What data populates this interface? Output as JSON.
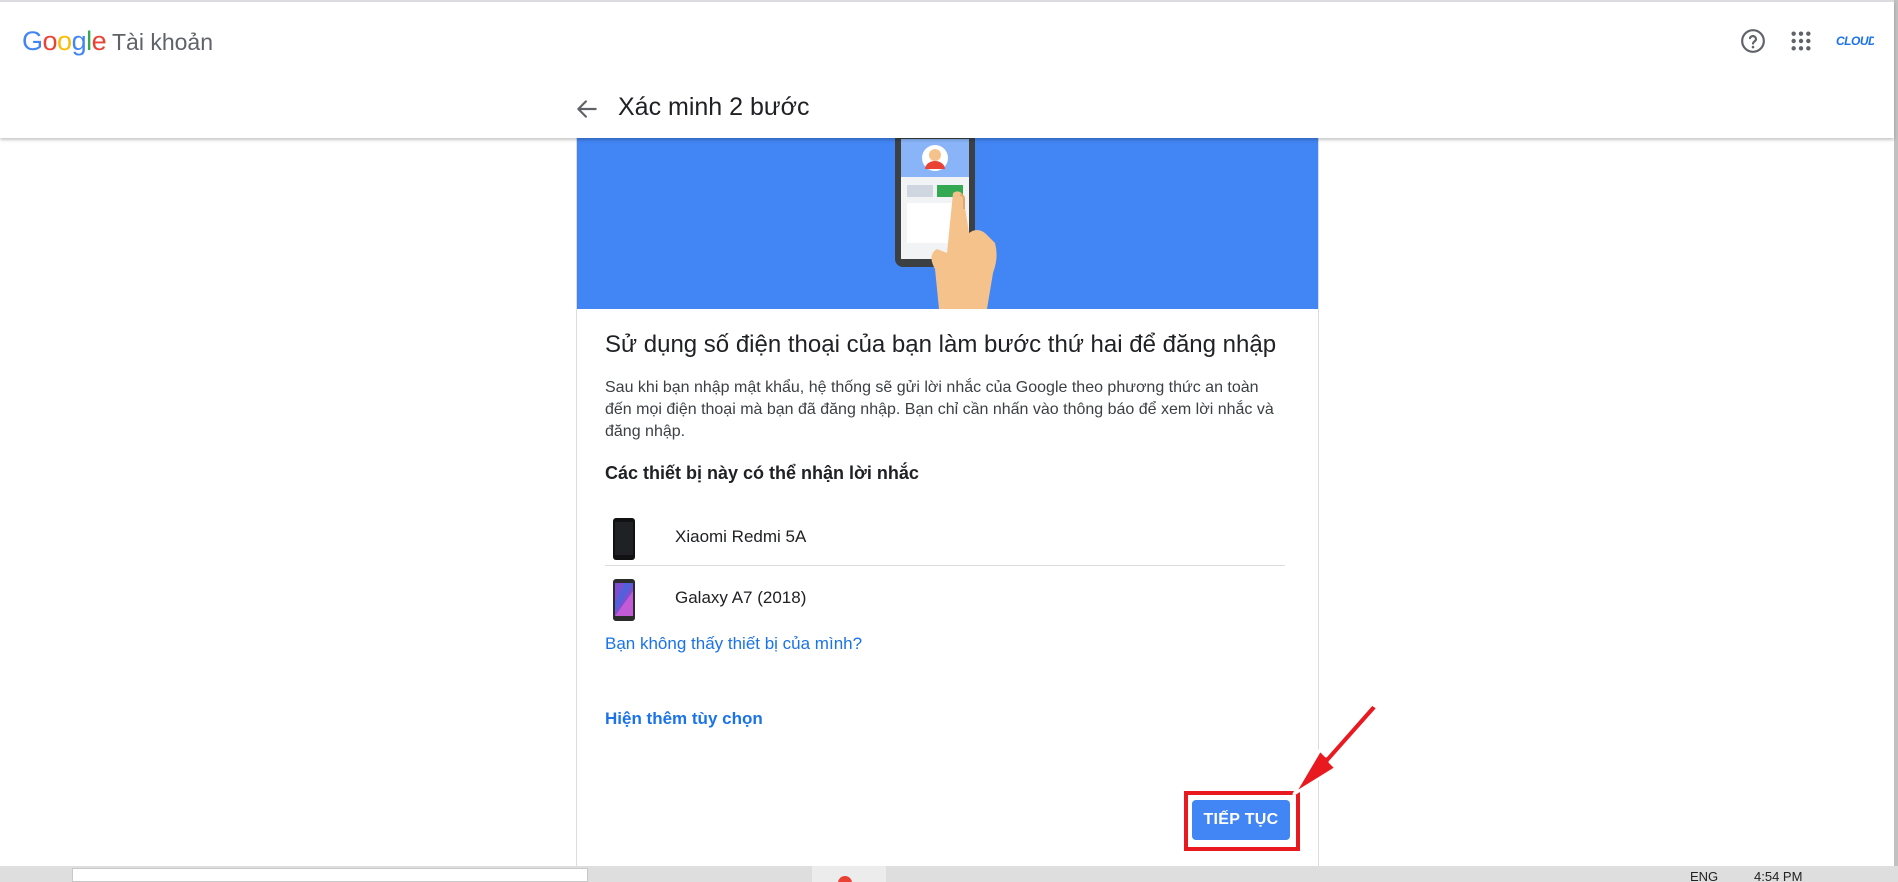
{
  "header": {
    "logo_letters": [
      "G",
      "o",
      "o",
      "g",
      "l",
      "e"
    ],
    "product": "Tài khoản",
    "avatar_text": "CLOUD",
    "title": "Xác minh 2 bước"
  },
  "icons": {
    "help": "help-circle-icon",
    "apps": "apps-grid-icon",
    "back": "arrow-back-icon",
    "phone": "smartphone-icon"
  },
  "colors": {
    "google_blue": "#4285f4",
    "link_blue": "#1a73e8",
    "highlight_red": "#e8191f"
  },
  "card": {
    "headline": "Sử dụng số điện thoại của bạn làm bước thứ hai để đăng nhập",
    "description": "Sau khi bạn nhập mật khẩu, hệ thống sẽ gửi lời nhắc của Google theo phương thức an toàn đến mọi điện thoại mà bạn đã đăng nhập. Bạn chỉ cần nhấn vào thông báo để xem lời nhắc và đăng nhập.",
    "devices_heading": "Các thiết bị này có thể nhận lời nhắc",
    "devices": [
      {
        "name": "Xiaomi Redmi 5A"
      },
      {
        "name": "Galaxy A7 (2018)"
      }
    ],
    "missing_device_link": "Bạn không thấy thiết bị của mình?",
    "more_options_link": "Hiện thêm tùy chọn",
    "continue_button": "TIẾP TỤC"
  },
  "taskbar": {
    "language": "ENG",
    "clock": "4:54 PM"
  }
}
